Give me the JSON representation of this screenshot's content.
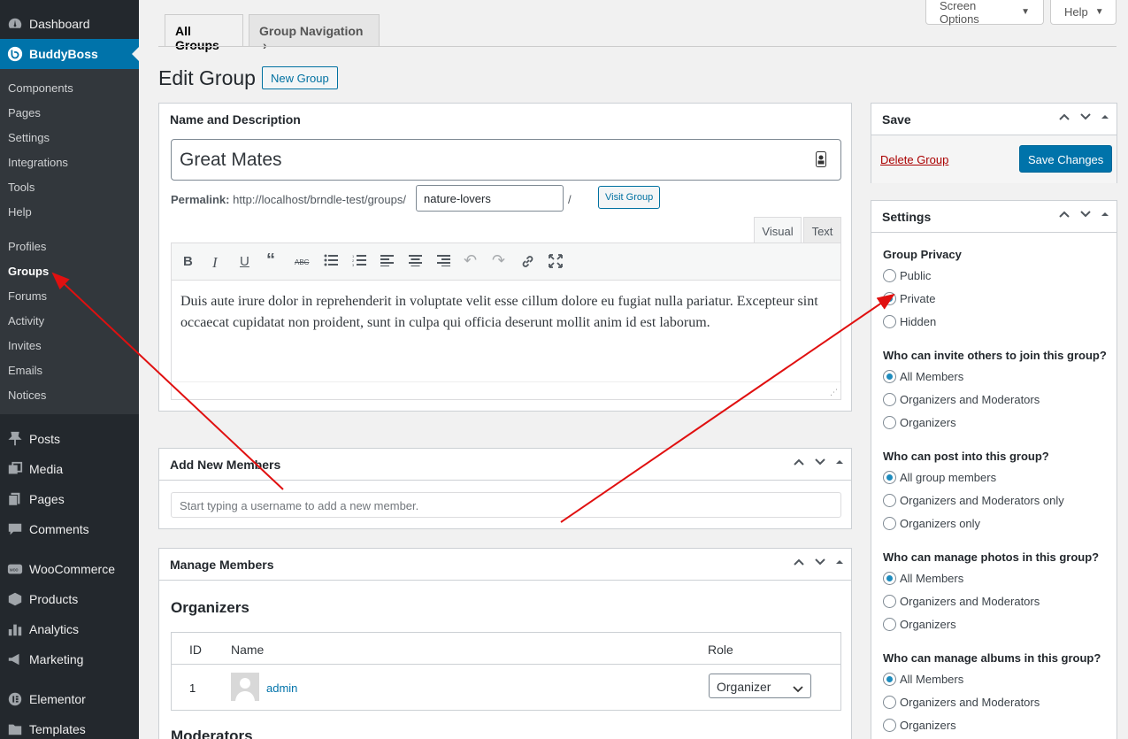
{
  "sidebar": {
    "top_items": [
      {
        "label": "Dashboard",
        "icon": "dashboard-icon"
      },
      {
        "label": "BuddyBoss",
        "icon": "buddyboss-icon"
      }
    ],
    "submenu": [
      "Components",
      "Pages",
      "Settings",
      "Integrations",
      "Tools",
      "Help",
      "Profiles",
      "Groups",
      "Forums",
      "Activity",
      "Invites",
      "Emails",
      "Notices"
    ],
    "current_submenu": "Groups",
    "bottom_items": [
      {
        "label": "Posts",
        "icon": "pin-icon"
      },
      {
        "label": "Media",
        "icon": "media-icon"
      },
      {
        "label": "Pages",
        "icon": "page-icon"
      },
      {
        "label": "Comments",
        "icon": "comment-icon"
      },
      {
        "label": "WooCommerce",
        "icon": "woo-icon"
      },
      {
        "label": "Products",
        "icon": "box-icon"
      },
      {
        "label": "Analytics",
        "icon": "bar-chart-icon"
      },
      {
        "label": "Marketing",
        "icon": "megaphone-icon"
      },
      {
        "label": "Elementor",
        "icon": "elementor-icon"
      },
      {
        "label": "Templates",
        "icon": "folder-icon"
      }
    ]
  },
  "top_buttons": {
    "screen_options": "Screen Options",
    "help": "Help"
  },
  "tabs": {
    "all_groups": "All Groups",
    "group_navigation": "Group Navigation"
  },
  "page": {
    "title": "Edit Group",
    "new_group": "New Group"
  },
  "name_desc": {
    "title": "Name and Description",
    "group_name": "Great Mates",
    "permalink_label": "Permalink:",
    "permalink_base": "http://localhost/brndle-test/groups/",
    "slug": "nature-lovers",
    "slash": "/",
    "visit_group": "Visit Group",
    "editor_tabs": {
      "visual": "Visual",
      "text": "Text"
    },
    "content": "Duis aute irure dolor in reprehenderit in voluptate velit esse cillum dolore eu fugiat nulla pariatur. Excepteur sint occaecat cupidatat non proident, sunt in culpa qui officia deserunt mollit anim id est laborum."
  },
  "add_members": {
    "title": "Add New Members",
    "placeholder": "Start typing a username to add a new member."
  },
  "manage_members": {
    "title": "Manage Members",
    "organizers_heading": "Organizers",
    "columns": {
      "id": "ID",
      "name": "Name",
      "role": "Role"
    },
    "rows": [
      {
        "id": "1",
        "name": "admin",
        "role": "Organizer"
      }
    ],
    "moderators_heading": "Moderators"
  },
  "save_box": {
    "title": "Save",
    "delete": "Delete Group",
    "save": "Save Changes"
  },
  "settings_box": {
    "title": "Settings",
    "groups": [
      {
        "label": "Group Privacy",
        "options": [
          "Public",
          "Private",
          "Hidden"
        ],
        "selected": 1
      },
      {
        "label": "Who can invite others to join this group?",
        "options": [
          "All Members",
          "Organizers and Moderators",
          "Organizers"
        ],
        "selected": 0
      },
      {
        "label": "Who can post into this group?",
        "options": [
          "All group members",
          "Organizers and Moderators only",
          "Organizers only"
        ],
        "selected": 0
      },
      {
        "label": "Who can manage photos in this group?",
        "options": [
          "All Members",
          "Organizers and Moderators",
          "Organizers"
        ],
        "selected": 0
      },
      {
        "label": "Who can manage albums in this group?",
        "options": [
          "All Members",
          "Organizers and Moderators",
          "Organizers"
        ],
        "selected": 0
      }
    ]
  },
  "colors": {
    "accent": "#0073aa",
    "sidebar": "#23282d",
    "annotation_arrow": "#e01010"
  }
}
